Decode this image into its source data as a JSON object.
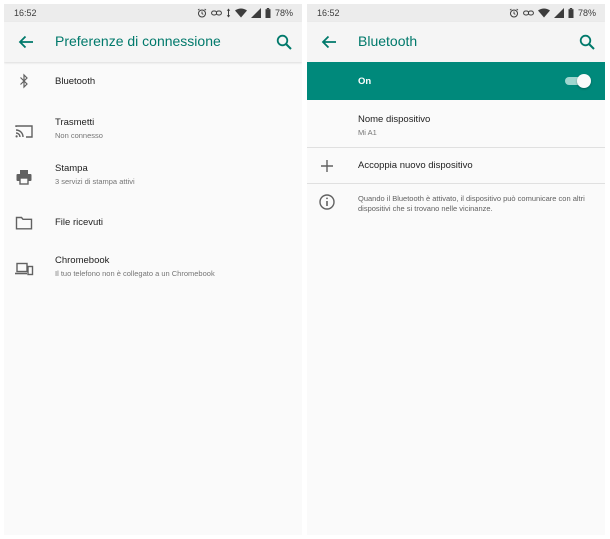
{
  "left_screen": {
    "status": {
      "time": "16:52",
      "battery": "78%"
    },
    "appbar": {
      "title": "Preferenze di connessione"
    },
    "items": [
      {
        "icon": "bluetooth-icon",
        "title": "Bluetooth",
        "subtitle": ""
      },
      {
        "icon": "cast-icon",
        "title": "Trasmetti",
        "subtitle": "Non connesso"
      },
      {
        "icon": "printer-icon",
        "title": "Stampa",
        "subtitle": "3 servizi di stampa attivi"
      },
      {
        "icon": "folder-icon",
        "title": "File ricevuti",
        "subtitle": ""
      },
      {
        "icon": "devices-icon",
        "title": "Chromebook",
        "subtitle": "Il tuo telefono non è collegato a un Chromebook"
      }
    ]
  },
  "right_screen": {
    "status": {
      "time": "16:52",
      "battery": "78%"
    },
    "appbar": {
      "title": "Bluetooth"
    },
    "toggle": {
      "label": "On",
      "state": "on"
    },
    "device_name": {
      "title": "Nome dispositivo",
      "value": "Mi A1"
    },
    "pair": {
      "label": "Accoppia nuovo dispositivo"
    },
    "info": {
      "text": "Quando il Bluetooth è attivato, il dispositivo può comunicare con altri dispositivi che si trovano nelle vicinanze."
    }
  },
  "colors": {
    "accent": "#00796b",
    "toggle_bar": "#00897b",
    "appbar_bg": "#f5f5f5",
    "statusbar_bg": "#ececec"
  }
}
